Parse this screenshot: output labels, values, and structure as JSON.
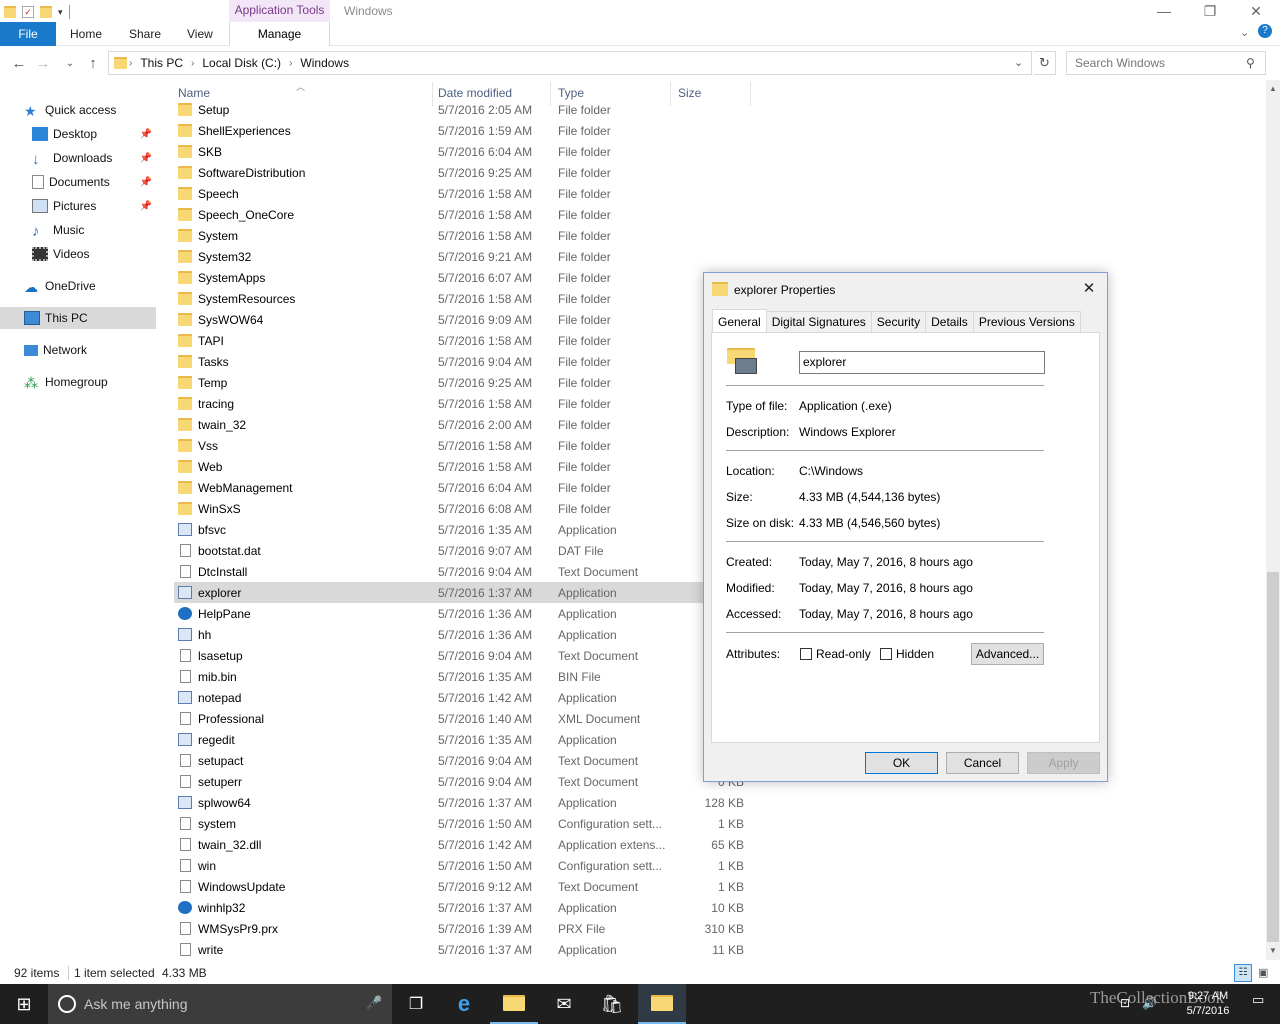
{
  "titlebar": {
    "contextual_tab": "Application Tools",
    "title": "Windows"
  },
  "ribbon": {
    "file": "File",
    "home": "Home",
    "share": "Share",
    "view": "View",
    "manage": "Manage"
  },
  "address": {
    "crumbs": [
      "This PC",
      "Local Disk (C:)",
      "Windows"
    ],
    "search_placeholder": "Search Windows"
  },
  "nav": {
    "quick_access": "Quick access",
    "desktop": "Desktop",
    "downloads": "Downloads",
    "documents": "Documents",
    "pictures": "Pictures",
    "music": "Music",
    "videos": "Videos",
    "onedrive": "OneDrive",
    "thispc": "This PC",
    "network": "Network",
    "homegroup": "Homegroup"
  },
  "columns": {
    "name": "Name",
    "date": "Date modified",
    "type": "Type",
    "size": "Size"
  },
  "rows": [
    {
      "name": "Setup",
      "date": "5/7/2016 2:05 AM",
      "type": "File folder",
      "size": "",
      "kind": "folder"
    },
    {
      "name": "ShellExperiences",
      "date": "5/7/2016 1:59 AM",
      "type": "File folder",
      "size": "",
      "kind": "folder"
    },
    {
      "name": "SKB",
      "date": "5/7/2016 6:04 AM",
      "type": "File folder",
      "size": "",
      "kind": "folder"
    },
    {
      "name": "SoftwareDistribution",
      "date": "5/7/2016 9:25 AM",
      "type": "File folder",
      "size": "",
      "kind": "folder"
    },
    {
      "name": "Speech",
      "date": "5/7/2016 1:58 AM",
      "type": "File folder",
      "size": "",
      "kind": "folder"
    },
    {
      "name": "Speech_OneCore",
      "date": "5/7/2016 1:58 AM",
      "type": "File folder",
      "size": "",
      "kind": "folder"
    },
    {
      "name": "System",
      "date": "5/7/2016 1:58 AM",
      "type": "File folder",
      "size": "",
      "kind": "folder"
    },
    {
      "name": "System32",
      "date": "5/7/2016 9:21 AM",
      "type": "File folder",
      "size": "",
      "kind": "folder"
    },
    {
      "name": "SystemApps",
      "date": "5/7/2016 6:07 AM",
      "type": "File folder",
      "size": "",
      "kind": "folder"
    },
    {
      "name": "SystemResources",
      "date": "5/7/2016 1:58 AM",
      "type": "File folder",
      "size": "",
      "kind": "folder"
    },
    {
      "name": "SysWOW64",
      "date": "5/7/2016 9:09 AM",
      "type": "File folder",
      "size": "",
      "kind": "folder"
    },
    {
      "name": "TAPI",
      "date": "5/7/2016 1:58 AM",
      "type": "File folder",
      "size": "",
      "kind": "folder"
    },
    {
      "name": "Tasks",
      "date": "5/7/2016 9:04 AM",
      "type": "File folder",
      "size": "",
      "kind": "folder"
    },
    {
      "name": "Temp",
      "date": "5/7/2016 9:25 AM",
      "type": "File folder",
      "size": "",
      "kind": "folder"
    },
    {
      "name": "tracing",
      "date": "5/7/2016 1:58 AM",
      "type": "File folder",
      "size": "",
      "kind": "folder"
    },
    {
      "name": "twain_32",
      "date": "5/7/2016 2:00 AM",
      "type": "File folder",
      "size": "",
      "kind": "folder"
    },
    {
      "name": "Vss",
      "date": "5/7/2016 1:58 AM",
      "type": "File folder",
      "size": "",
      "kind": "folder"
    },
    {
      "name": "Web",
      "date": "5/7/2016 1:58 AM",
      "type": "File folder",
      "size": "",
      "kind": "folder"
    },
    {
      "name": "WebManagement",
      "date": "5/7/2016 6:04 AM",
      "type": "File folder",
      "size": "",
      "kind": "folder"
    },
    {
      "name": "WinSxS",
      "date": "5/7/2016 6:08 AM",
      "type": "File folder",
      "size": "",
      "kind": "folder"
    },
    {
      "name": "bfsvc",
      "date": "5/7/2016 1:35 AM",
      "type": "Application",
      "size": "",
      "kind": "app"
    },
    {
      "name": "bootstat.dat",
      "date": "5/7/2016 9:07 AM",
      "type": "DAT File",
      "size": "",
      "kind": "doc"
    },
    {
      "name": "DtcInstall",
      "date": "5/7/2016 9:04 AM",
      "type": "Text Document",
      "size": "",
      "kind": "doc"
    },
    {
      "name": "explorer",
      "date": "5/7/2016 1:37 AM",
      "type": "Application",
      "size": "",
      "kind": "app",
      "selected": true
    },
    {
      "name": "HelpPane",
      "date": "5/7/2016 1:36 AM",
      "type": "Application",
      "size": "",
      "kind": "help"
    },
    {
      "name": "hh",
      "date": "5/7/2016 1:36 AM",
      "type": "Application",
      "size": "",
      "kind": "app"
    },
    {
      "name": "lsasetup",
      "date": "5/7/2016 9:04 AM",
      "type": "Text Document",
      "size": "",
      "kind": "doc"
    },
    {
      "name": "mib.bin",
      "date": "5/7/2016 1:35 AM",
      "type": "BIN File",
      "size": "",
      "kind": "doc"
    },
    {
      "name": "notepad",
      "date": "5/7/2016 1:42 AM",
      "type": "Application",
      "size": "",
      "kind": "app"
    },
    {
      "name": "Professional",
      "date": "5/7/2016 1:40 AM",
      "type": "XML Document",
      "size": "",
      "kind": "doc"
    },
    {
      "name": "regedit",
      "date": "5/7/2016 1:35 AM",
      "type": "Application",
      "size": "",
      "kind": "app"
    },
    {
      "name": "setupact",
      "date": "5/7/2016 9:04 AM",
      "type": "Text Document",
      "size": "",
      "kind": "doc"
    },
    {
      "name": "setuperr",
      "date": "5/7/2016 9:04 AM",
      "type": "Text Document",
      "size": "0 KB",
      "kind": "doc"
    },
    {
      "name": "splwow64",
      "date": "5/7/2016 1:37 AM",
      "type": "Application",
      "size": "128 KB",
      "kind": "app"
    },
    {
      "name": "system",
      "date": "5/7/2016 1:50 AM",
      "type": "Configuration sett...",
      "size": "1 KB",
      "kind": "doc"
    },
    {
      "name": "twain_32.dll",
      "date": "5/7/2016 1:42 AM",
      "type": "Application extens...",
      "size": "65 KB",
      "kind": "doc"
    },
    {
      "name": "win",
      "date": "5/7/2016 1:50 AM",
      "type": "Configuration sett...",
      "size": "1 KB",
      "kind": "doc"
    },
    {
      "name": "WindowsUpdate",
      "date": "5/7/2016 9:12 AM",
      "type": "Text Document",
      "size": "1 KB",
      "kind": "doc"
    },
    {
      "name": "winhlp32",
      "date": "5/7/2016 1:37 AM",
      "type": "Application",
      "size": "10 KB",
      "kind": "help"
    },
    {
      "name": "WMSysPr9.prx",
      "date": "5/7/2016 1:39 AM",
      "type": "PRX File",
      "size": "310 KB",
      "kind": "doc"
    },
    {
      "name": "write",
      "date": "5/7/2016 1:37 AM",
      "type": "Application",
      "size": "11 KB",
      "kind": "doc"
    }
  ],
  "status": {
    "count": "92 items",
    "selected": "1 item selected",
    "size": "4.33 MB"
  },
  "taskbar": {
    "cortana_placeholder": "Ask me anything",
    "time": "9:27 AM",
    "date": "5/7/2016",
    "watermark": "TheCollectionBook"
  },
  "dialog": {
    "title": "explorer Properties",
    "tabs": [
      "General",
      "Digital Signatures",
      "Security",
      "Details",
      "Previous Versions"
    ],
    "name_value": "explorer",
    "type_label": "Type of file:",
    "type_value": "Application (.exe)",
    "desc_label": "Description:",
    "desc_value": "Windows Explorer",
    "loc_label": "Location:",
    "loc_value": "C:\\Windows",
    "size_label": "Size:",
    "size_value": "4.33 MB (4,544,136 bytes)",
    "disk_label": "Size on disk:",
    "disk_value": "4.33 MB (4,546,560 bytes)",
    "created_label": "Created:",
    "created_value": "Today, May 7, 2016, 8 hours ago",
    "modified_label": "Modified:",
    "modified_value": "Today, May 7, 2016, 8 hours ago",
    "accessed_label": "Accessed:",
    "accessed_value": "Today, May 7, 2016, 8 hours ago",
    "attr_label": "Attributes:",
    "readonly": "Read-only",
    "hidden": "Hidden",
    "advanced": "Advanced...",
    "ok": "OK",
    "cancel": "Cancel",
    "apply": "Apply"
  }
}
